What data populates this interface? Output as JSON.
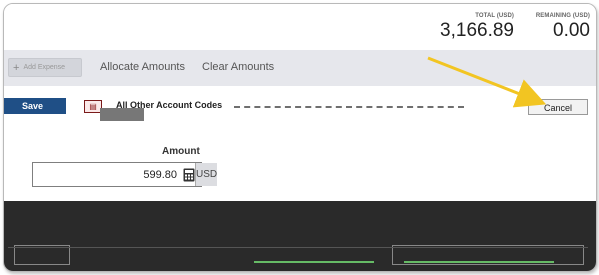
{
  "totals": {
    "total_label": "TOTAL (USD)",
    "total_value": "3,166.89",
    "remaining_label": "REMAINING (USD)",
    "remaining_value": "0.00"
  },
  "toolbar": {
    "add_expense_label": "Add Expense",
    "allocate_label": "Allocate Amounts",
    "clear_label": "Clear Amounts"
  },
  "expense": {
    "save_label": "Save",
    "type_label": "All Other Account Codes",
    "cancel_label": "Cancel"
  },
  "amount": {
    "label": "Amount",
    "value": "599.80",
    "currency": "USD"
  },
  "colors": {
    "arrow": "#f2c522",
    "save_bg": "#1f4f86"
  }
}
